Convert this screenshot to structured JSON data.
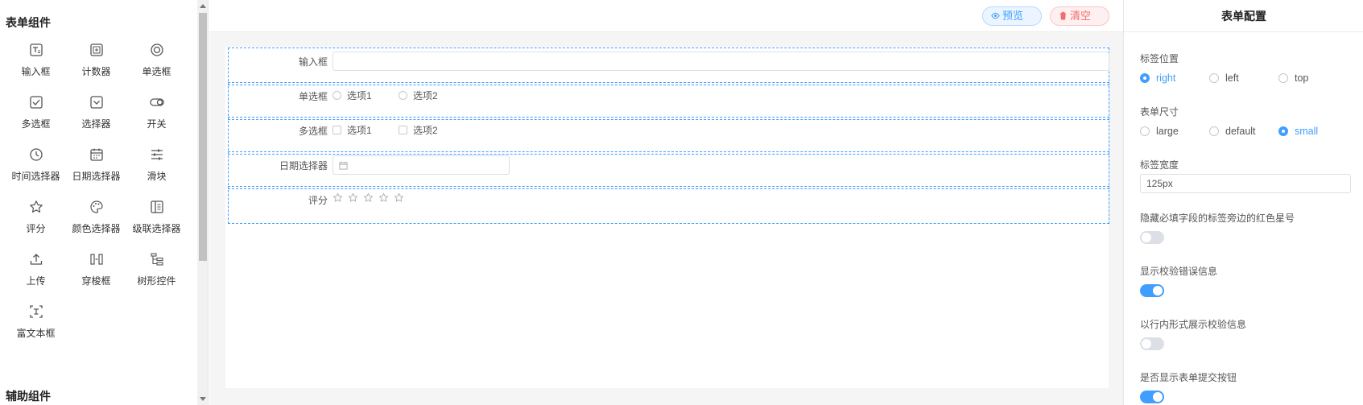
{
  "left_panel": {
    "form_section_title": "表单组件",
    "aux_section_title": "辅助组件",
    "components": [
      {
        "label": "输入框",
        "icon": "input-icon"
      },
      {
        "label": "计数器",
        "icon": "counter-icon"
      },
      {
        "label": "单选框",
        "icon": "radio-icon"
      },
      {
        "label": "多选框",
        "icon": "checkbox-icon"
      },
      {
        "label": "选择器",
        "icon": "select-icon"
      },
      {
        "label": "开关",
        "icon": "switch-icon"
      },
      {
        "label": "时间选择器",
        "icon": "clock-icon"
      },
      {
        "label": "日期选择器",
        "icon": "calendar-icon"
      },
      {
        "label": "滑块",
        "icon": "slider-icon"
      },
      {
        "label": "评分",
        "icon": "star-icon"
      },
      {
        "label": "颜色选择器",
        "icon": "palette-icon"
      },
      {
        "label": "级联选择器",
        "icon": "cascader-icon"
      },
      {
        "label": "上传",
        "icon": "upload-icon"
      },
      {
        "label": "穿梭框",
        "icon": "transfer-icon"
      },
      {
        "label": "树形控件",
        "icon": "tree-icon"
      },
      {
        "label": "富文本框",
        "icon": "rich-text-icon"
      }
    ]
  },
  "toolbar": {
    "preview_label": "预览",
    "clear_label": "清空"
  },
  "form": {
    "rows": [
      {
        "label": "输入框",
        "type": "input"
      },
      {
        "label": "单选框",
        "type": "radio",
        "options": [
          "选项1",
          "选项2"
        ]
      },
      {
        "label": "多选框",
        "type": "checkbox",
        "options": [
          "选项1",
          "选项2"
        ]
      },
      {
        "label": "日期选择器",
        "type": "date"
      },
      {
        "label": "评分",
        "type": "rate",
        "max": 5,
        "value": 0
      }
    ]
  },
  "config": {
    "title": "表单配置",
    "label_position": {
      "label": "标签位置",
      "options": [
        "right",
        "left",
        "top"
      ],
      "selected": "right"
    },
    "form_size": {
      "label": "表单尺寸",
      "options": [
        "large",
        "default",
        "small"
      ],
      "selected": "small"
    },
    "label_width": {
      "label": "标签宽度",
      "value": "125px"
    },
    "hide_required_asterisk": {
      "label": "隐藏必填字段的标签旁边的红色星号",
      "on": false
    },
    "show_message": {
      "label": "显示校验错误信息",
      "on": true
    },
    "inline_message": {
      "label": "以行内形式展示校验信息",
      "on": false
    },
    "show_submit": {
      "label": "是否显示表单提交按钮",
      "on": true
    }
  },
  "colors": {
    "accent": "#409eff",
    "danger": "#f56c6c",
    "dashed_border": "#409eff"
  }
}
